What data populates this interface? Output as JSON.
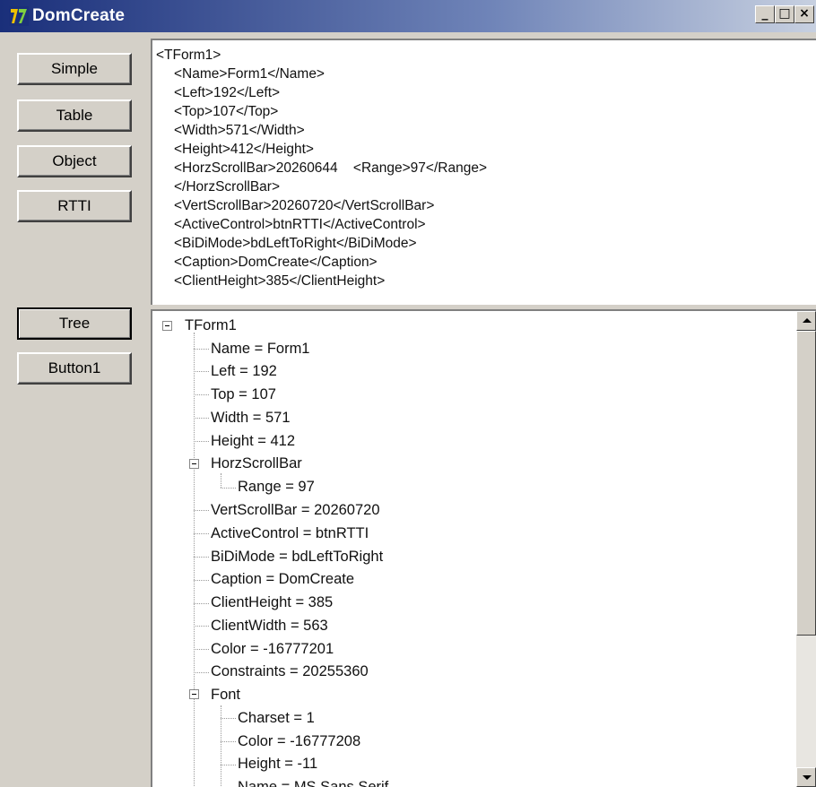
{
  "window": {
    "title": "DomCreate",
    "minimize": "_",
    "maximize": "□",
    "close": "×"
  },
  "buttons": {
    "simple": "Simple",
    "table": "Table",
    "object": "Object",
    "rtti": "RTTI",
    "tree": "Tree",
    "button1": "Button1"
  },
  "memo": {
    "lines": [
      "<TForm1>",
      "<Name>Form1</Name>",
      "<Left>192</Left>",
      "<Top>107</Top>",
      "<Width>571</Width>",
      "<Height>412</Height>",
      "<HorzScrollBar>20260644    <Range>97</Range>",
      "</HorzScrollBar>",
      "<VertScrollBar>20260720</VertScrollBar>",
      "<ActiveControl>btnRTTI</ActiveControl>",
      "<BiDiMode>bdLeftToRight</BiDiMode>",
      "<Caption>DomCreate</Caption>",
      "<ClientHeight>385</ClientHeight>"
    ]
  },
  "tree": {
    "nodes": [
      "TForm1",
      "Name = Form1",
      "Left = 192",
      "Top = 107",
      "Width = 571",
      "Height = 412",
      "HorzScrollBar",
      "Range = 97",
      "VertScrollBar = 20260720",
      "ActiveControl = btnRTTI",
      "BiDiMode = bdLeftToRight",
      "Caption = DomCreate",
      "ClientHeight = 385",
      "ClientWidth = 563",
      "Color = -16777201",
      "Constraints = 20255360",
      "Font",
      "Charset = 1",
      "Color = -16777208",
      "Height = -11",
      "Name = MS Sans Serif"
    ]
  },
  "colors": {
    "titlebar_start": "#1a2f7a",
    "window_bg": "#d4d0c8"
  }
}
